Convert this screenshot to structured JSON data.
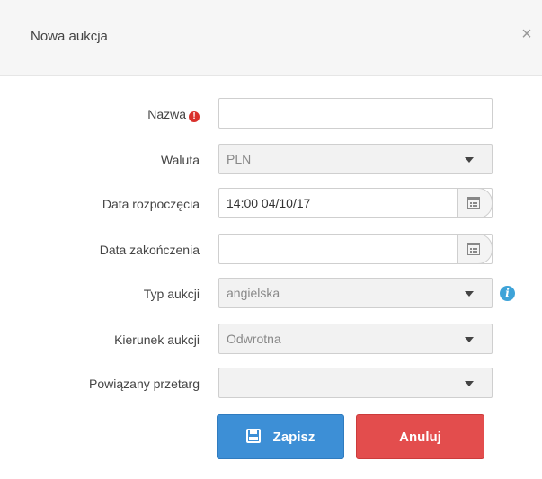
{
  "dialog": {
    "title": "Nowa aukcja",
    "close_symbol": "×"
  },
  "form": {
    "name": {
      "label": "Nazwa",
      "required_mark": "!",
      "value": ""
    },
    "currency": {
      "label": "Waluta",
      "value": "PLN"
    },
    "start_date": {
      "label": "Data rozpoczęcia",
      "value": "14:00 04/10/17"
    },
    "end_date": {
      "label": "Data zakończenia",
      "value": ""
    },
    "auction_type": {
      "label": "Typ aukcji",
      "value": "angielska",
      "info_symbol": "i"
    },
    "direction": {
      "label": "Kierunek aukcji",
      "value": "Odwrotna"
    },
    "related_tender": {
      "label": "Powiązany przetarg",
      "value": ""
    }
  },
  "buttons": {
    "save": "Zapisz",
    "cancel": "Anuluj"
  },
  "colors": {
    "save": "#3d8fd6",
    "cancel": "#e34d4d",
    "required": "#d9302c",
    "info": "#3ea3d8"
  },
  "icons": {
    "close": "close-icon",
    "required": "exclamation-icon",
    "calendar": "calendar-icon",
    "info": "info-icon",
    "dropdown": "chevron-down-icon",
    "save": "floppy-disk-icon"
  }
}
